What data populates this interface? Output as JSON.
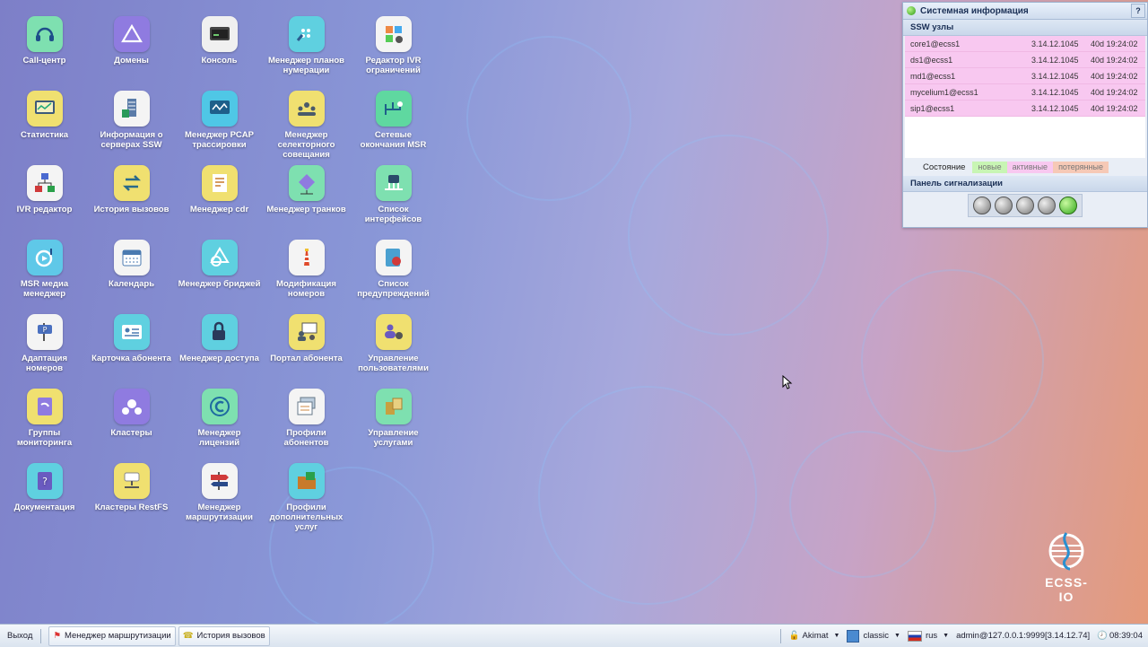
{
  "desktop": {
    "icons": [
      {
        "label": "Call-центр",
        "icon": "headset-icon",
        "bg": "#7ee0b0"
      },
      {
        "label": "Домены",
        "icon": "triangle-icon",
        "bg": "#8f7be0"
      },
      {
        "label": "Консоль",
        "icon": "terminal-icon",
        "bg": "#f0f0f0"
      },
      {
        "label": "Менеджер планов нумерации",
        "icon": "dialplan-icon",
        "bg": "#5fd0e0"
      },
      {
        "label": "Редактор IVR ограничений",
        "icon": "ivr-restrict-icon",
        "bg": "#f4f4f4"
      },
      {
        "label": "Статистика",
        "icon": "monitor-chart-icon",
        "bg": "#f0e070"
      },
      {
        "label": "Информация о серверах SSW",
        "icon": "server-info-icon",
        "bg": "#f4f4f4"
      },
      {
        "label": "Менеджер PCAP трассировки",
        "icon": "pcap-icon",
        "bg": "#4fc7e6"
      },
      {
        "label": "Менеджер селекторного совещания",
        "icon": "conference-icon",
        "bg": "#f0e070"
      },
      {
        "label": "Сетевые окончания MSR",
        "icon": "network-endpoint-icon",
        "bg": "#5fd8a0"
      },
      {
        "label": "IVR редактор",
        "icon": "ivr-editor-icon",
        "bg": "#f4f4f4"
      },
      {
        "label": "История вызовов",
        "icon": "call-history-icon",
        "bg": "#f0e070"
      },
      {
        "label": "Менеджер cdr",
        "icon": "cdr-icon",
        "bg": "#f0e070"
      },
      {
        "label": "Менеджер транков",
        "icon": "trunk-icon",
        "bg": "#7ee0b0"
      },
      {
        "label": "Список интерфейсов",
        "icon": "interfaces-icon",
        "bg": "#7ee0b0"
      },
      {
        "label": "MSR медиа менеджер",
        "icon": "media-manager-icon",
        "bg": "#5fc8e8"
      },
      {
        "label": "Календарь",
        "icon": "calendar-icon",
        "bg": "#f4f4f4"
      },
      {
        "label": "Менеджер бриджей",
        "icon": "bridge-icon",
        "bg": "#5fd0e0"
      },
      {
        "label": "Модификация номеров",
        "icon": "lighthouse-icon",
        "bg": "#f4f4f4"
      },
      {
        "label": "Список предупреждений",
        "icon": "alarm-list-icon",
        "bg": "#f4f4f4"
      },
      {
        "label": "Адаптация номеров",
        "icon": "signpost-icon",
        "bg": "#f4f4f4"
      },
      {
        "label": "Карточка абонента",
        "icon": "id-card-icon",
        "bg": "#5fd0e0"
      },
      {
        "label": "Менеджер доступа",
        "icon": "access-lock-icon",
        "bg": "#5fd0e0"
      },
      {
        "label": "Портал абонента",
        "icon": "portal-icon",
        "bg": "#f0e070"
      },
      {
        "label": "Управление пользователями",
        "icon": "users-gear-icon",
        "bg": "#f0e070"
      },
      {
        "label": "Группы мониторинга",
        "icon": "monitor-groups-icon",
        "bg": "#f0e070"
      },
      {
        "label": "Кластеры",
        "icon": "cluster-icon",
        "bg": "#8f7be0"
      },
      {
        "label": "Менеджер лицензий",
        "icon": "copyright-icon",
        "bg": "#7ee0b0"
      },
      {
        "label": "Профили абонентов",
        "icon": "profiles-icon",
        "bg": "#f4f4f4"
      },
      {
        "label": "Управление услугами",
        "icon": "services-icon",
        "bg": "#7ee0b0"
      },
      {
        "label": "Документация",
        "icon": "help-book-icon",
        "bg": "#5fd0e0"
      },
      {
        "label": "Кластеры RestFS",
        "icon": "restfs-icon",
        "bg": "#f0e070"
      },
      {
        "label": "Менеджер маршрутизации",
        "icon": "routing-icon",
        "bg": "#f4f4f4"
      },
      {
        "label": "Профили дополнительных услуг",
        "icon": "folder-services-icon",
        "bg": "#5fd0e0"
      }
    ]
  },
  "sysinfo": {
    "title": "Системная информация",
    "help": "?",
    "ssw_section": "SSW узлы",
    "nodes": [
      {
        "name": "core1@ecss1",
        "version": "3.14.12.1045",
        "uptime": "40d 19:24:02"
      },
      {
        "name": "ds1@ecss1",
        "version": "3.14.12.1045",
        "uptime": "40d 19:24:02"
      },
      {
        "name": "md1@ecss1",
        "version": "3.14.12.1045",
        "uptime": "40d 19:24:02"
      },
      {
        "name": "mycelium1@ecss1",
        "version": "3.14.12.1045",
        "uptime": "40d 19:24:02"
      },
      {
        "name": "sip1@ecss1",
        "version": "3.14.12.1045",
        "uptime": "40d 19:24:02"
      }
    ],
    "legend": {
      "label": "Состояние",
      "new": "новые",
      "active": "активные",
      "lost": "потерянные"
    },
    "legend_colors": {
      "new": "#c8f5b4",
      "active": "#f8c8f0",
      "lost": "#f6c9b6"
    },
    "alarm_section": "Панель сигнализации",
    "leds": [
      "off",
      "off",
      "off",
      "off",
      "on"
    ]
  },
  "logo": {
    "text": "ECSS-IO"
  },
  "taskbar": {
    "exit": "Выход",
    "windows": [
      "Менеджер маршрутизации",
      "История вызовов"
    ],
    "user": "Akimat",
    "theme": "classic",
    "lang": "rus",
    "session": "admin@127.0.0.1:9999[3.14.12.74]",
    "time": "08:39:04"
  }
}
